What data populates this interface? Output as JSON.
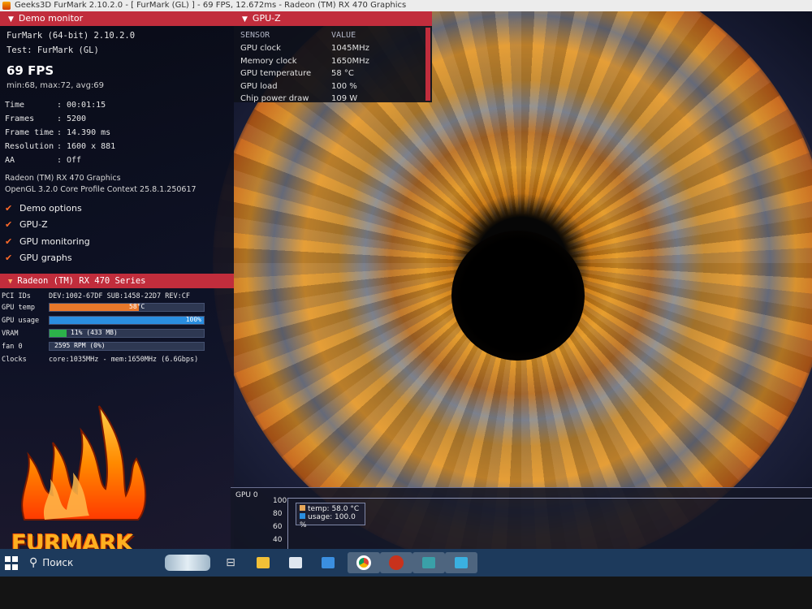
{
  "titlebar": {
    "text": "Geeks3D FurMark 2.10.2.0 - [ FurMark (GL) ] - 69 FPS, 12.672ms - Radeon (TM) RX 470 Graphics"
  },
  "demo_monitor": {
    "header": "Demo monitor",
    "app_line": "FurMark (64-bit) 2.10.2.0",
    "test_line": "Test: FurMark (GL)",
    "fps": "69 FPS",
    "minmax": "min:68, max:72, avg:69",
    "stats": [
      {
        "key": "Time",
        "value": "00:01:15"
      },
      {
        "key": "Frames",
        "value": "5200"
      },
      {
        "key": "Frame time",
        "value": "14.390 ms"
      },
      {
        "key": "Resolution",
        "value": "1600 x 881"
      },
      {
        "key": "AA",
        "value": "Off"
      }
    ],
    "gpu_name": "Radeon (TM) RX 470 Graphics",
    "gl_context": "OpenGL 3.2.0 Core Profile Context 25.8.1.250617",
    "options": [
      "Demo options",
      "GPU-Z",
      "GPU monitoring",
      "GPU graphs"
    ]
  },
  "gpu_series": {
    "header": "Radeon (TM) RX 470 Series",
    "pci_label": "PCI IDs",
    "pci_value": "DEV:1002-67DF SUB:1458-22D7 REV:CF",
    "temp_label": "GPU temp",
    "temp_text": "58°C",
    "temp_fraction": 0.58,
    "usage_label": "GPU usage",
    "usage_text": "100%",
    "usage_fraction": 1.0,
    "vram_label": "VRAM",
    "vram_text": "11% (433 MB)",
    "vram_fraction": 0.11,
    "fan_label": "fan 0",
    "fan_text": "2595 RPM (0%)",
    "fan_fraction": 0.0,
    "clocks_label": "Clocks",
    "clocks_value": "core:1035MHz - mem:1650MHz (6.6Gbps)"
  },
  "logo": {
    "text": "FURMARK"
  },
  "gpuz": {
    "header": "GPU-Z",
    "col_sensor": "SENSOR",
    "col_value": "VALUE",
    "rows": [
      {
        "key": "GPU clock",
        "value": "1045MHz"
      },
      {
        "key": "Memory clock",
        "value": "1650MHz"
      },
      {
        "key": "GPU temperature",
        "value": "58 °C"
      },
      {
        "key": "GPU load",
        "value": "100 %"
      },
      {
        "key": "Chip power draw",
        "value": "109 W"
      }
    ]
  },
  "graph": {
    "title": "GPU 0",
    "yticks": [
      "100",
      "80",
      "60",
      "40"
    ],
    "legend_temp": "temp: 58.0 °C",
    "legend_usage": "usage: 100.0 %"
  },
  "taskbar": {
    "search": "Поиск"
  },
  "colors": {
    "header_red": "#c12d3c",
    "temp_orange": "#e8782a",
    "usage_blue": "#2a8ee0",
    "vram_green": "#2cb24a",
    "taskbar": "#1d3a5c"
  }
}
